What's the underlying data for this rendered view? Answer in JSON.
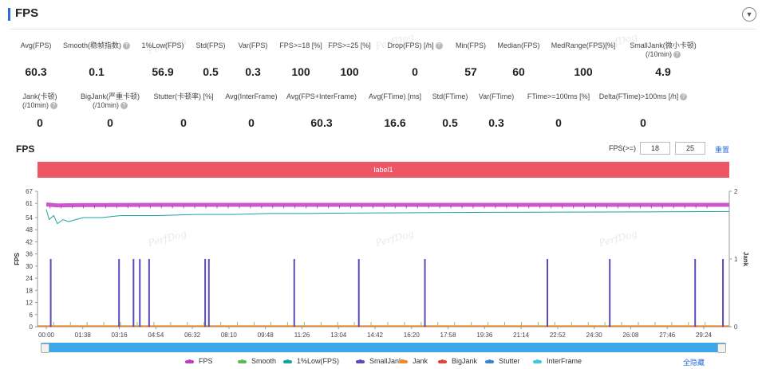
{
  "header": {
    "title": "FPS",
    "collapse_icon": "chevron-down-icon"
  },
  "watermark": "PerfDog",
  "stats_row1": [
    {
      "label": "Avg(FPS)",
      "value": "60.3",
      "help": false
    },
    {
      "label": "Smooth(稳帧指数)",
      "value": "0.1",
      "help": true
    },
    {
      "label": "1%Low(FPS)",
      "value": "56.9",
      "help": false
    },
    {
      "label": "Std(FPS)",
      "value": "0.5",
      "help": false
    },
    {
      "label": "Var(FPS)",
      "value": "0.3",
      "help": false
    },
    {
      "label": "FPS>=18 [%]",
      "value": "100",
      "help": false
    },
    {
      "label": "FPS>=25 [%]",
      "value": "100",
      "help": false
    },
    {
      "label": "Drop(FPS) [/h]",
      "value": "0",
      "help": true
    },
    {
      "label": "Min(FPS)",
      "value": "57",
      "help": false
    },
    {
      "label": "Median(FPS)",
      "value": "60",
      "help": false
    },
    {
      "label": "MedRange(FPS)[%]",
      "value": "100",
      "help": false
    },
    {
      "label": "SmallJank(微小卡顿)",
      "label2": "(/10min)",
      "value": "4.9",
      "help": true
    }
  ],
  "stats_row2": [
    {
      "label": "Jank(卡顿)",
      "label2": "(/10min)",
      "value": "0",
      "help": true
    },
    {
      "label": "BigJank(严重卡顿)",
      "label2": "(/10min)",
      "value": "0",
      "help": true
    },
    {
      "label": "Stutter(卡顿率) [%]",
      "value": "0",
      "help": false
    },
    {
      "label": "Avg(InterFrame)",
      "value": "0",
      "help": false
    },
    {
      "label": "Avg(FPS+InterFrame)",
      "value": "60.3",
      "help": false
    },
    {
      "label": "Avg(FTime) [ms]",
      "value": "16.6",
      "help": false
    },
    {
      "label": "Std(FTime)",
      "value": "0.5",
      "help": false
    },
    {
      "label": "Var(FTime)",
      "value": "0.3",
      "help": false
    },
    {
      "label": "FTime>=100ms [%]",
      "value": "0",
      "help": false
    },
    {
      "label": "Delta(FTime)>100ms [/h]",
      "value": "0",
      "help": true
    }
  ],
  "chart_section": {
    "title": "FPS",
    "threshold_label": "FPS(>=)",
    "threshold_low": "18",
    "threshold_high": "25",
    "reset_label": "重置",
    "label_bar": "label1",
    "hide_all_label": "全隐藏"
  },
  "chart_data": {
    "type": "line",
    "ylabel": "FPS",
    "y2label": "Jank",
    "ylim": [
      0,
      67
    ],
    "y2lim": [
      0,
      2
    ],
    "yticks": [
      0,
      6,
      12,
      18,
      24,
      30,
      36,
      42,
      48,
      54,
      61,
      67
    ],
    "y2ticks": [
      0,
      1,
      2
    ],
    "xticks": [
      "00:00",
      "01:38",
      "03:16",
      "04:54",
      "06:32",
      "08:10",
      "09:48",
      "11:26",
      "13:04",
      "14:42",
      "16:20",
      "17:58",
      "19:36",
      "21:14",
      "22:52",
      "24:30",
      "26:08",
      "27:46",
      "29:24"
    ],
    "duration_s": 1840,
    "series": [
      {
        "name": "FPS",
        "color": "#c23cc2",
        "x": [
          0,
          30,
          100,
          300,
          600,
          900,
          1200,
          1500,
          1800,
          1840
        ],
        "y": [
          60.5,
          60,
          60.2,
          60.3,
          60.3,
          60.3,
          60.3,
          60.3,
          60.3,
          60.3
        ]
      },
      {
        "name": "Smooth",
        "color": "#5cb85c",
        "x": [
          0,
          1840
        ],
        "y": [
          0,
          0
        ]
      },
      {
        "name": "1%Low(FPS)",
        "color": "#1aa3a3",
        "x": [
          0,
          8,
          20,
          30,
          45,
          60,
          80,
          100,
          150,
          200,
          250,
          300,
          400,
          500,
          600,
          700,
          800,
          900,
          1000,
          1200,
          1400,
          1600,
          1840
        ],
        "y": [
          58,
          53,
          55,
          51,
          53,
          52,
          53,
          54,
          54,
          55,
          55,
          55,
          55.5,
          55.5,
          56,
          56,
          56.2,
          56.3,
          56.4,
          56.6,
          56.7,
          56.8,
          57
        ]
      },
      {
        "name": "SmallJank",
        "color": "#5a4bb8",
        "x": [
          12,
          196,
          235,
          252,
          277,
          428,
          438,
          668,
          842,
          1020,
          1350,
          1518,
          1748,
          1823
        ],
        "y": [
          1,
          1,
          1,
          1,
          1,
          1,
          1,
          1,
          1,
          1,
          1,
          1,
          1,
          1
        ]
      },
      {
        "name": "Jank",
        "color": "#ee8c2d",
        "x": [
          0,
          1840
        ],
        "y": [
          0,
          0
        ]
      },
      {
        "name": "BigJank",
        "color": "#e0453a",
        "x": [
          0,
          1840
        ],
        "y": [
          0,
          0
        ]
      },
      {
        "name": "Stutter",
        "color": "#3b86c9",
        "x": [
          0,
          1840
        ],
        "y": [
          0,
          0
        ]
      },
      {
        "name": "InterFrame",
        "color": "#42c7de",
        "x": [
          0,
          1840
        ],
        "y": [
          0,
          0
        ]
      }
    ]
  }
}
